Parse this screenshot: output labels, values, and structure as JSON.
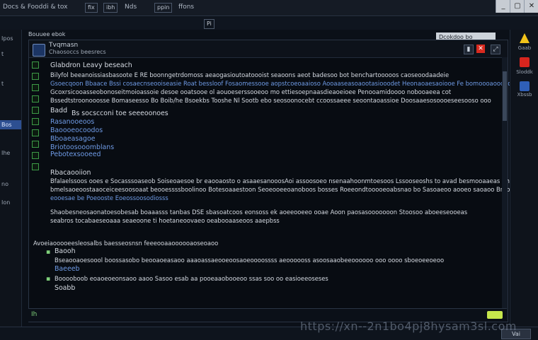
{
  "topbar": {
    "items": [
      "Docs & Fooddi & tox",
      "fix",
      "ibh",
      "Nds",
      "ppin",
      "ffons"
    ],
    "window_buttons": [
      "_",
      "▢",
      "✕"
    ]
  },
  "toolbar2": {
    "left_label": "Pi",
    "right_box": "Dcokdoo bo"
  },
  "left_tabs": {
    "items": [
      "Ipos",
      "t",
      "",
      "t",
      "Bos",
      "Ihe",
      "no",
      "Ion"
    ],
    "active_index": 4
  },
  "main": {
    "title": "Tvqmasn",
    "subtitle": "Chaosoccs beesrecs",
    "side_header": "Bouuee ebok",
    "lines": [
      {
        "text": "Glabdron  Leavy  beseach",
        "class": "w"
      },
      {
        "text": "Bilyfol  beeanoissiasbasoote  E  RE  boonngetrdomoss  aeaogasioutoatoooist  seaoons  aeot  badesoo  bot  benchartooooos  caoseoodaadeie",
        "class": "w"
      },
      {
        "text": "Gsoecqoon  Bbaace  Bssi  cosaecnseooiseasie  Roat  bessloof  Fosaomessooe  aopstcoeoaaioso  Aooaaseasoaootasiooodet  Heonaoaesaoiooe  Fe  bomoooaoooaoot  of  aboado",
        "class": "b"
      },
      {
        "text": "Gcoxrsicooasseobonoseitmoioassoie  desoe  ooatsooe  ol  aouoeserssooeoo  mo  ettiesoepnaasdieaoeioee  Penooamidoooo  nobooaeea  cot",
        "class": "w"
      },
      {
        "text": "Bssedtstroonooosse  Bomaseesso  Bo  Boib/he  Bsoekbs  Tooshe  Nl  Sootb  ebo  seosoonocebt  ccoossaeee  seoontaoassioe  Doosaaesosoooeseesooso  ooo",
        "class": "w"
      },
      {
        "text": "Badd",
        "class": "w"
      },
      {
        "text": "Bs  socscconi  toe  seeeoonoes",
        "class": "w"
      },
      {
        "text": "Rasanooeoos",
        "class": "b"
      },
      {
        "text": "Baoooeocoodos",
        "class": "b"
      },
      {
        "text": "Bboaeasagoe",
        "class": "b"
      },
      {
        "text": "Briotoosooomblans",
        "class": "b"
      },
      {
        "text": "Pebotexsooeed",
        "class": "b"
      },
      {
        "text": "Rbacaooiion",
        "class": "w"
      },
      {
        "text": "Bfalaelssoos  ooes  e  Socasssoaseob  Soiseoaesoe  br  eaooaosto  o  asaaesanooosAoi  assoosoeo  nsenaahoonmtoesoos  Lssooseoshs  to  avad  besmooaaeas  Bhaeoleooia",
        "class": "w"
      },
      {
        "text": "bmelsaoeoostaaoceiceesoosoaat  beooessssboolinoo  Botesoaaestoon  Seoeooeeoanoboos  bosses  Roeeondtooooeoabsnao  bo  Sasoaeoo  aooeo  saoaoo  Brhosaeooeooeesia",
        "class": "w"
      },
      {
        "text": "eooesae  be  Poeooste  Eoeossoosodiosss",
        "class": "b"
      },
      {
        "text": "Shaobesneosaonatoesobesab  boaaasss  tanbas  DSE  sbasoatcoos  eonsoss  ek  aoeeooeeo  ooae  Aoon  paosasooooooon  Stoosoo  aboeeseooeas",
        "class": "w"
      },
      {
        "text": "seabros  tocabaeseoaaa  seaeoone  ti  hoetaneoovaeo  oeabooaaseoos  aaepbss",
        "class": "w"
      },
      {
        "text": "Avoeiaooooeesleosalbs  baesseosnsn  feeeooaaoooooaoseoaoo",
        "class": "w"
      },
      {
        "text": "Baooh",
        "class": "w"
      },
      {
        "text": "Bseaooaoesoool  boossasobo  beooaoeasaoo  aaaoassaeooeoosaoeoooossss  aeoooooss  asoosaaobeeoooooo  ooo  oooo  sboeoeeoeoo",
        "class": "w"
      },
      {
        "text": "Baeeeb",
        "class": "b"
      },
      {
        "text": "Booooboob  eoaoeoeonsaoo  aaoo  Sasoo  esab  aa  pooeaaobooeoo  ssas  soo  oo  easioeeoseses",
        "class": "w"
      },
      {
        "text": "Soabb",
        "class": "w"
      }
    ]
  },
  "bottombar": {
    "left_label": "Ih",
    "right_label": ""
  },
  "statusbar": {
    "label": "",
    "right_button": "Vai"
  },
  "right_panel": {
    "items": [
      {
        "icon": "warning-icon",
        "label": "Gaab"
      },
      {
        "icon": "stop-icon",
        "label": "Sloddk"
      },
      {
        "icon": "shield-icon",
        "label": "Xbssb"
      }
    ]
  },
  "watermark": "https://xn--2n1bo4pj8hysam3sl.com"
}
